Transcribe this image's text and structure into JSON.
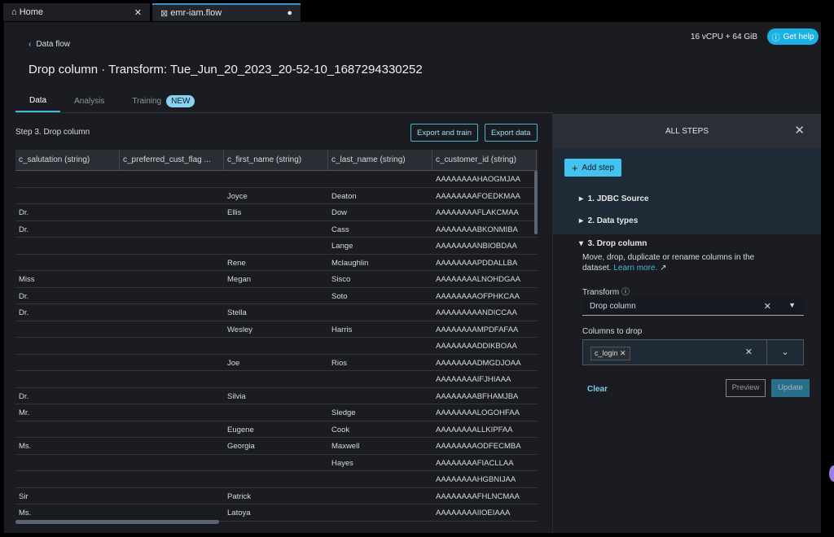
{
  "tabs": [
    {
      "label": "Home",
      "icon": "home-icon"
    },
    {
      "label": "emr-iam.flow",
      "icon": "flow-icon"
    }
  ],
  "header": {
    "back": "Data flow",
    "title": "Drop column · Transform: Tue_Jun_20_2023_20-52-10_1687294330252",
    "resources": "16 vCPU + 64 GiB",
    "help": "Get help"
  },
  "view_tabs": [
    "Data",
    "Analysis",
    "Training"
  ],
  "new_badge": "NEW",
  "step_label": "Step 3. Drop column",
  "export_train": "Export and train",
  "export_data": "Export data",
  "columns": [
    "c_salutation (string)",
    "c_preferred_cust_flag ...",
    "c_first_name (string)",
    "c_last_name (string)",
    "c_customer_id (string)"
  ],
  "rows": [
    [
      "",
      "",
      "",
      "",
      "AAAAAAAAHAOGMJAA"
    ],
    [
      "",
      "",
      "Joyce",
      "Deaton",
      "AAAAAAAAFOEDKMAA"
    ],
    [
      "Dr.",
      "",
      "Ellis",
      "Dow",
      "AAAAAAAAFLAKCMAA"
    ],
    [
      "Dr.",
      "",
      "",
      "Cass",
      "AAAAAAAABKONMIBA"
    ],
    [
      "",
      "",
      "",
      "Lange",
      "AAAAAAAANBIOBDAA"
    ],
    [
      "",
      "",
      "Rene",
      "Mclaughlin",
      "AAAAAAAAPDDALLBA"
    ],
    [
      "Miss",
      "",
      "Megan",
      "Sisco",
      "AAAAAAAALNOHDGAA"
    ],
    [
      "Dr.",
      "",
      "",
      "Soto",
      "AAAAAAAAOFPHKCAA"
    ],
    [
      "Dr.",
      "",
      "Stella",
      "",
      "AAAAAAAAANDICCAA"
    ],
    [
      "",
      "",
      "Wesley",
      "Harris",
      "AAAAAAAAMPDFAFAA"
    ],
    [
      "",
      "",
      "",
      "",
      "AAAAAAAADDIKBOAA"
    ],
    [
      "",
      "",
      "Joe",
      "Rios",
      "AAAAAAAADMGDJOAA"
    ],
    [
      "",
      "",
      "",
      "",
      "AAAAAAAAIFJHIAAA"
    ],
    [
      "Dr.",
      "",
      "Silvia",
      "",
      "AAAAAAAABFHAMJBA"
    ],
    [
      "Mr.",
      "",
      "",
      "Sledge",
      "AAAAAAAALOGOHFAA"
    ],
    [
      "",
      "",
      "Eugene",
      "Cook",
      "AAAAAAAALLKIPFAA"
    ],
    [
      "Ms.",
      "",
      "Georgia",
      "Maxwell",
      "AAAAAAAAODFECMBA"
    ],
    [
      "",
      "",
      "",
      "Hayes",
      "AAAAAAAAFIACLLAA"
    ],
    [
      "",
      "",
      "",
      "",
      "AAAAAAAAHGBNIJAA"
    ],
    [
      "Sir",
      "",
      "Patrick",
      "",
      "AAAAAAAAFHLNCMAA"
    ],
    [
      "Ms.",
      "",
      "Latoya",
      "",
      "AAAAAAAAIIOEIAAA"
    ]
  ],
  "panel": {
    "title": "ALL STEPS",
    "add_step": "Add step",
    "steps": [
      "1. JDBC Source",
      "2. Data types",
      "3. Drop column"
    ],
    "description": "Move, drop, duplicate or rename columns in the dataset.",
    "learn_more": "Learn more.",
    "transform_label": "Transform",
    "transform_value": "Drop column",
    "columns_label": "Columns to drop",
    "chip": "c_login",
    "clear": "Clear",
    "preview": "Preview",
    "update": "Update"
  },
  "colors": {
    "accent": "#44b9d6",
    "help": "#1ab1e6",
    "add_step": "#44c3f0",
    "update": "#2a6f8a"
  }
}
